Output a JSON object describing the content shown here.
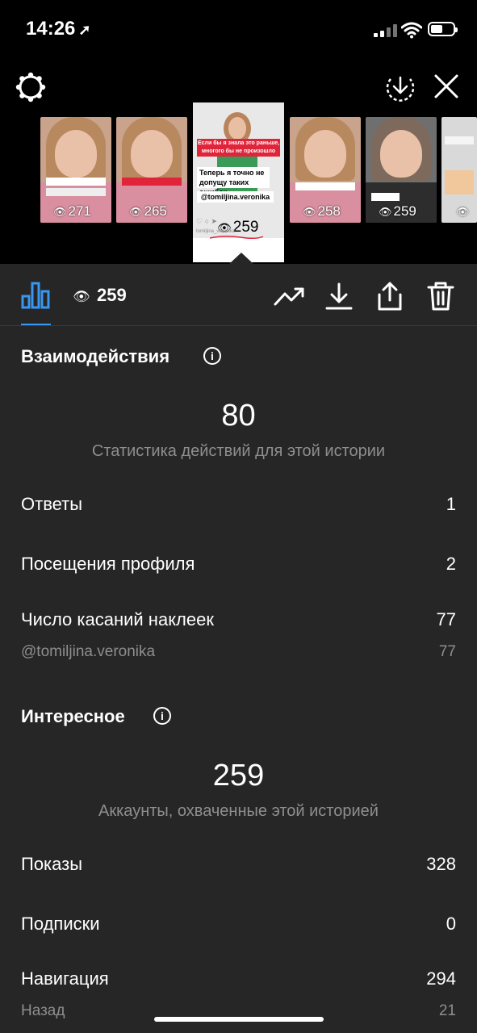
{
  "status_bar": {
    "time": "14:26",
    "location_arrow": "location-arrow-icon"
  },
  "stories": [
    {
      "views": "271"
    },
    {
      "views": "265"
    },
    {
      "views": "259",
      "current": true,
      "caption_red": "Если бы я знала это раньше, многого бы не произошло",
      "caption_white": "Теперь я точно не допущу таких ошибок",
      "user_tag": "@tomiljina.veronika",
      "account": "tomiljina_veronika"
    },
    {
      "views": "258"
    },
    {
      "views": "259"
    },
    {
      "views": ""
    }
  ],
  "toolbar": {
    "views_count": "259"
  },
  "interactions": {
    "title": "Взаимодействия",
    "total": "80",
    "total_label": "Статистика действий для этой истории",
    "rows": [
      {
        "label": "Ответы",
        "value": "1"
      },
      {
        "label": "Посещения профиля",
        "value": "2"
      },
      {
        "label": "Число касаний наклеек",
        "value": "77"
      }
    ],
    "sub_row": {
      "label": "@tomiljina.veronika",
      "value": "77"
    }
  },
  "discovery": {
    "title": "Интересное",
    "total": "259",
    "total_label": "Аккаунты, охваченные этой историей",
    "rows": [
      {
        "label": "Показы",
        "value": "328"
      },
      {
        "label": "Подписки",
        "value": "0"
      },
      {
        "label": "Навигация",
        "value": "294"
      }
    ],
    "sub_row": {
      "label": "Назад",
      "value": "21"
    }
  },
  "colors": {
    "accent": "#3897f0",
    "panel": "#262626",
    "muted": "#8e8e8e",
    "story_red": "#e0243a"
  }
}
